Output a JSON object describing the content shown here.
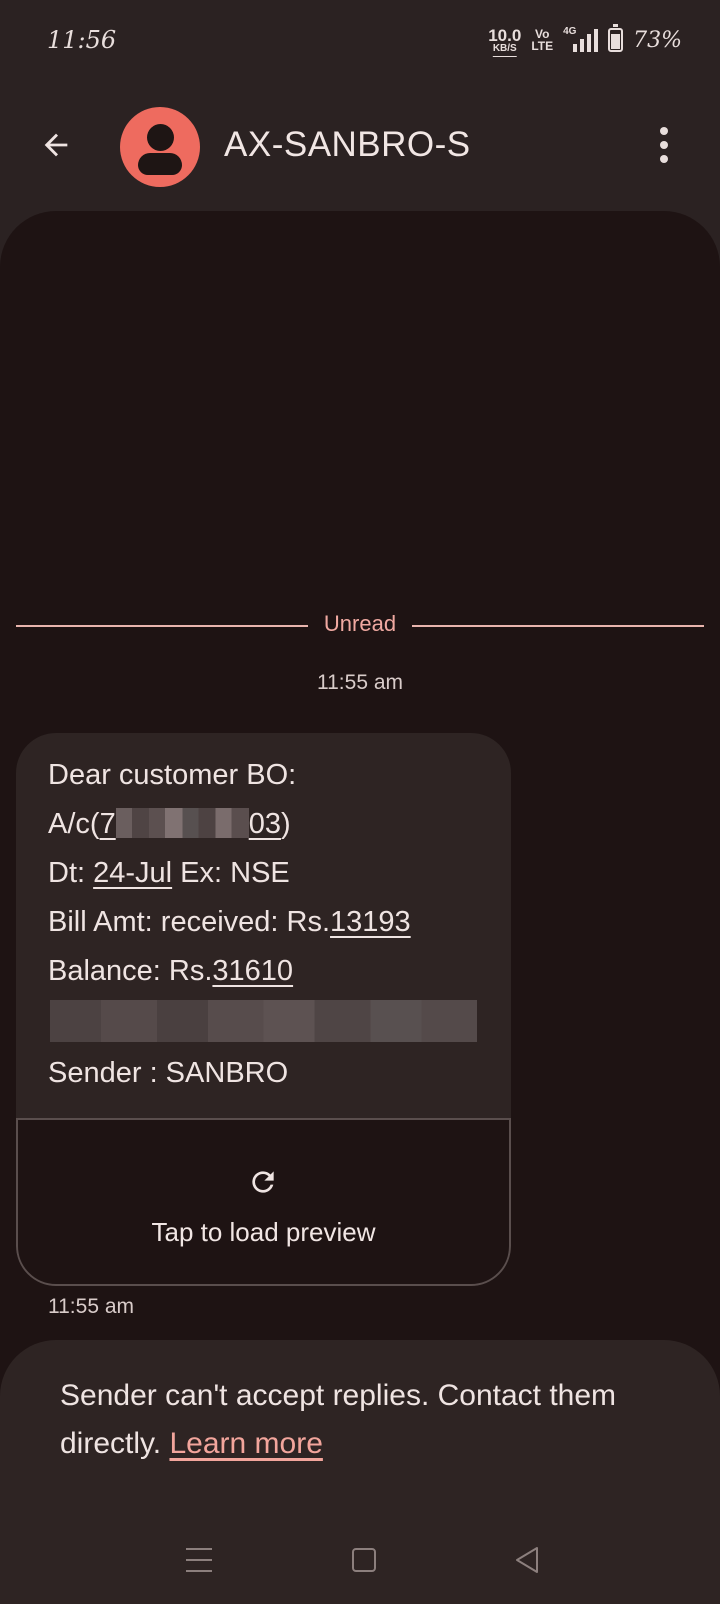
{
  "status_bar": {
    "time": "11:56",
    "net_speed": "10.0",
    "net_unit": "KB/S",
    "volte_top": "Vo",
    "volte_bottom": "LTE",
    "network": "4G",
    "battery": "73%",
    "battery_level": 0.73
  },
  "header": {
    "contact_name": "AX-SANBRO-S",
    "avatar_color": "#ee6b5f",
    "back_icon": "arrow-left-icon",
    "menu_icon": "more-vert-icon"
  },
  "conversation": {
    "unread_label": "Unread",
    "timestamp_top": "11:55 am",
    "message": {
      "line1": "Dear customer BO:",
      "acct_prefix": "A/c(",
      "acct_first": "7",
      "acct_last": "03",
      "acct_suffix": ")",
      "date_prefix": "Dt: ",
      "date_value": "24-Jul",
      "date_suffix": " Ex: NSE",
      "bill_prefix": "Bill Amt: received: Rs.",
      "bill_value": "13193",
      "balance_prefix": "Balance: Rs.",
      "balance_value": "31610",
      "sender_line": "Sender : SANBRO"
    },
    "preview": {
      "label": "Tap to load preview",
      "icon": "refresh-icon"
    },
    "timestamp_bottom": "11:55 am"
  },
  "reply_notice": {
    "text": "Sender can't accept replies. Contact them directly. ",
    "link": "Learn more"
  },
  "nav_bar": {
    "recent_icon": "recent-apps-icon",
    "home_icon": "home-icon",
    "back_icon": "nav-back-icon"
  },
  "colors": {
    "background": "#2b2222",
    "conversation_bg": "#1e1313",
    "bubble_bg": "#2e2423",
    "accent": "#f0a9a1"
  }
}
